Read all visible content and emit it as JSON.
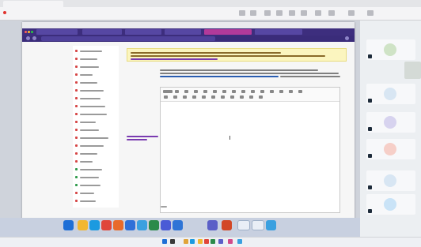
{
  "host_window": {
    "tab_title": "",
    "address_text": "",
    "toolbar_icons": [
      "record-icon",
      "share-icon",
      "view-icon",
      "chat-icon",
      "people-icon",
      "apps-icon",
      "more-icon",
      "camera-icon",
      "mic-icon",
      "leave-icon"
    ]
  },
  "remote_browser": {
    "menu_text": "",
    "tabs": [
      {
        "label": "",
        "active": false
      },
      {
        "label": "",
        "active": false
      },
      {
        "label": "",
        "active": false
      },
      {
        "label": "",
        "active": false
      },
      {
        "label": "",
        "active": true
      },
      {
        "label": "",
        "active": false
      }
    ],
    "url": "",
    "accent_color": "#3d2e7e",
    "active_tab_color": "#b23a9a"
  },
  "course_nav": {
    "items": [
      {
        "label": "",
        "color": "#d64545"
      },
      {
        "label": "",
        "color": "#d64545"
      },
      {
        "label": "",
        "color": "#d64545"
      },
      {
        "label": "",
        "color": "#d64545"
      },
      {
        "label": "",
        "color": "#d64545"
      },
      {
        "label": "",
        "color": "#d64545"
      },
      {
        "label": "",
        "color": "#d64545"
      },
      {
        "label": "",
        "color": "#d64545"
      },
      {
        "label": "",
        "color": "#d64545"
      },
      {
        "label": "",
        "color": "#d64545"
      },
      {
        "label": "",
        "color": "#d64545"
      },
      {
        "label": "",
        "color": "#d64545"
      },
      {
        "label": "",
        "color": "#d64545"
      },
      {
        "label": "",
        "color": "#d64545"
      },
      {
        "label": "",
        "color": "#d64545"
      },
      {
        "label": "",
        "color": "#2e9a4a"
      },
      {
        "label": "",
        "color": "#2e9a4a"
      },
      {
        "label": "",
        "color": "#2e9a4a"
      },
      {
        "label": "",
        "color": "#d64545"
      },
      {
        "label": "",
        "color": "#d64545"
      }
    ]
  },
  "notice": {
    "text": "",
    "background": "#fbf5bf",
    "link_color": "#7a3bb0"
  },
  "intro": {
    "text": "",
    "link_text": "",
    "link_color": "#2a5db0"
  },
  "side_label": {
    "text": "",
    "color": "#7a3bb0"
  },
  "editor": {
    "toolbar_label": "",
    "body_text": "",
    "footer_text": ""
  },
  "remote_taskbar": {
    "apps": [
      {
        "name": "windows-icon",
        "color": "#1f6fd6"
      },
      {
        "name": "folder-icon",
        "color": "#f2b731"
      },
      {
        "name": "edge-icon",
        "color": "#1b9ae0"
      },
      {
        "name": "chrome-icon",
        "color": "#e0463a"
      },
      {
        "name": "firefox-icon",
        "color": "#e86a2a"
      },
      {
        "name": "mail-icon",
        "color": "#2f70d8"
      },
      {
        "name": "app-icon",
        "color": "#3aa0e0"
      },
      {
        "name": "app-icon",
        "color": "#2b8a4a"
      },
      {
        "name": "app-icon",
        "color": "#4a5bd6"
      },
      {
        "name": "store-icon",
        "color": "#2e74d6"
      },
      {
        "name": "teams-icon",
        "color": "#5b5fc7"
      },
      {
        "name": "powerpoint-icon",
        "color": "#d24726"
      },
      {
        "name": "window-thumb-icon",
        "color": "#e9eef6"
      },
      {
        "name": "window-thumb-icon",
        "color": "#e9eef6"
      },
      {
        "name": "app-icon",
        "color": "#3aa0e0"
      }
    ]
  },
  "participants": {
    "tiles": [
      {
        "initials": "",
        "avatar_color": "#cfe3c6"
      },
      {
        "initials": "",
        "avatar_color": "#d8e6f3"
      },
      {
        "initials": "",
        "avatar_color": "#d7d3ef"
      },
      {
        "initials": "",
        "avatar_color": "#f6cfc8"
      },
      {
        "initials": "",
        "avatar_color": "#d8e6f3"
      },
      {
        "initials": "",
        "avatar_color": "#c9e3f7"
      }
    ]
  },
  "host_taskbar": {
    "clock_text": "",
    "apps": [
      {
        "name": "windows-icon",
        "color": "#1f6fd6"
      },
      {
        "name": "search-icon",
        "color": "#3a3a3a"
      },
      {
        "name": "taskview-icon",
        "color": "#e0a43a"
      },
      {
        "name": "edge-icon",
        "color": "#1b9ae0"
      },
      {
        "name": "folder-icon",
        "color": "#f2b731"
      },
      {
        "name": "chrome-icon",
        "color": "#e0463a"
      },
      {
        "name": "app-icon",
        "color": "#2b8a4a"
      },
      {
        "name": "teams-icon",
        "color": "#5b5fc7"
      },
      {
        "name": "app-icon",
        "color": "#d24a8a"
      },
      {
        "name": "app-icon",
        "color": "#3aa0e0"
      }
    ]
  }
}
